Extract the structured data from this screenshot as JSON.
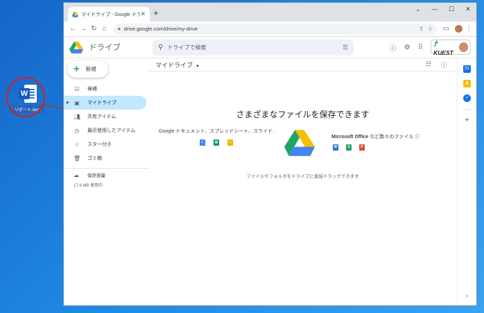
{
  "desktop": {
    "file_name": "リポート.docx"
  },
  "browser": {
    "tab_title": "マイドライブ - Google ドライブ",
    "url": "drive.google.com/drive/my-drive"
  },
  "drive": {
    "brand": "ドライブ",
    "search_placeholder": "ドライブで検索",
    "account_label": "KUEST",
    "new_button": "新規",
    "nav": [
      {
        "label": "候補",
        "icon": "check-icon"
      },
      {
        "label": "マイドライブ",
        "icon": "drive-icon",
        "active": true
      },
      {
        "label": "共有アイテム",
        "icon": "shared-icon"
      },
      {
        "label": "最近使用したアイテム",
        "icon": "clock-icon"
      },
      {
        "label": "スター付き",
        "icon": "star-icon"
      },
      {
        "label": "ゴミ箱",
        "icon": "trash-icon"
      }
    ],
    "storage": {
      "label": "保存容量",
      "used": "17.9 MB 使用中"
    },
    "main": {
      "title": "マイドライブ",
      "empty_heading": "さまざまなファイルを保存できます",
      "left_text": "Google ドキュメント、スプレッドシート、スライド.",
      "right_text_bold": "Microsoft Office",
      "right_text": " など数々のファイル",
      "hint": "ファイルやフォルダをドライブに直接ドラッグできます"
    }
  },
  "colors": {
    "active_nav": "#c2e7ff",
    "accent_red": "#d42020"
  }
}
